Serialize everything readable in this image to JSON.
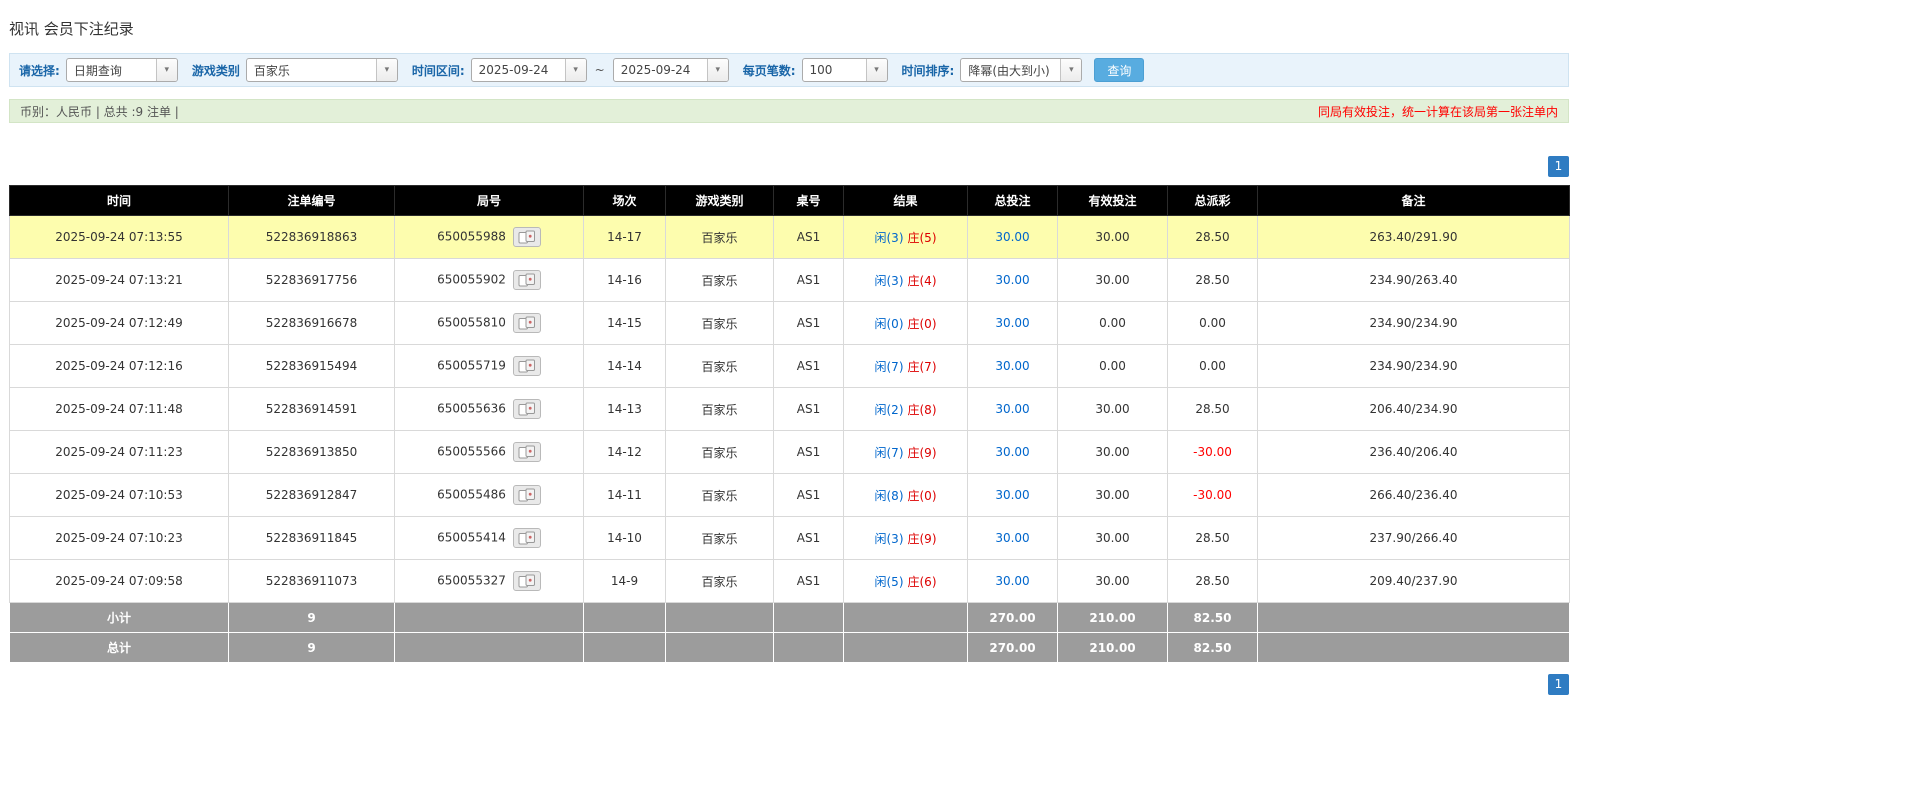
{
  "page": {
    "title": "视讯 会员下注纪录"
  },
  "colors": {
    "link-blue": "#0066cc",
    "banker-red": "#dd0000",
    "negative-red": "#ff0000",
    "header-bg": "#000000",
    "highlight": "#fdfdae",
    "summary-bg": "#e3f0d9",
    "filter-bg": "#e9f3fb",
    "label-blue": "#1a66a8",
    "button-blue": "#58ace0",
    "pagination-blue": "#2f7cc2",
    "footer-gray": "#9c9c9c"
  },
  "filters": {
    "select_label": "请选择:",
    "select_value": "日期查询",
    "game_type_label": "游戏类别",
    "game_type_value": "百家乐",
    "time_range_label": "时间区间:",
    "date_from": "2025-09-24",
    "range_separator": "~",
    "date_to": "2025-09-24",
    "page_size_label": "每页笔数:",
    "page_size_value": "100",
    "sort_label": "时间排序:",
    "sort_value": "降幂(由大到小)",
    "search_button": "查询"
  },
  "summary": {
    "left": "币别：人民币 | 总共 :9 注单 |",
    "right": "同局有效投注，统一计算在该局第一张注单内"
  },
  "pagination": {
    "page": "1"
  },
  "table": {
    "headers": [
      "时间",
      "注单编号",
      "局号",
      "场次",
      "游戏类别",
      "桌号",
      "结果",
      "总投注",
      "有效投注",
      "总派彩",
      "备注"
    ],
    "rows": [
      {
        "time": "2025-09-24 07:13:55",
        "bet_id": "522836918863",
        "round_id": "650055988",
        "session": "14-17",
        "game": "百家乐",
        "table_no": "AS1",
        "player": "闲(3)",
        "banker": "庄(5)",
        "total_bet": "30.00",
        "valid_bet": "30.00",
        "payout": "28.50",
        "remark": "263.40/291.90",
        "highlight": true
      },
      {
        "time": "2025-09-24 07:13:21",
        "bet_id": "522836917756",
        "round_id": "650055902",
        "session": "14-16",
        "game": "百家乐",
        "table_no": "AS1",
        "player": "闲(3)",
        "banker": "庄(4)",
        "total_bet": "30.00",
        "valid_bet": "30.00",
        "payout": "28.50",
        "remark": "234.90/263.40",
        "highlight": false
      },
      {
        "time": "2025-09-24 07:12:49",
        "bet_id": "522836916678",
        "round_id": "650055810",
        "session": "14-15",
        "game": "百家乐",
        "table_no": "AS1",
        "player": "闲(0)",
        "banker": "庄(0)",
        "total_bet": "30.00",
        "valid_bet": "0.00",
        "payout": "0.00",
        "remark": "234.90/234.90",
        "highlight": false
      },
      {
        "time": "2025-09-24 07:12:16",
        "bet_id": "522836915494",
        "round_id": "650055719",
        "session": "14-14",
        "game": "百家乐",
        "table_no": "AS1",
        "player": "闲(7)",
        "banker": "庄(7)",
        "total_bet": "30.00",
        "valid_bet": "0.00",
        "payout": "0.00",
        "remark": "234.90/234.90",
        "highlight": false
      },
      {
        "time": "2025-09-24 07:11:48",
        "bet_id": "522836914591",
        "round_id": "650055636",
        "session": "14-13",
        "game": "百家乐",
        "table_no": "AS1",
        "player": "闲(2)",
        "banker": "庄(8)",
        "total_bet": "30.00",
        "valid_bet": "30.00",
        "payout": "28.50",
        "remark": "206.40/234.90",
        "highlight": false
      },
      {
        "time": "2025-09-24 07:11:23",
        "bet_id": "522836913850",
        "round_id": "650055566",
        "session": "14-12",
        "game": "百家乐",
        "table_no": "AS1",
        "player": "闲(7)",
        "banker": "庄(9)",
        "total_bet": "30.00",
        "valid_bet": "30.00",
        "payout": "-30.00",
        "remark": "236.40/206.40",
        "highlight": false
      },
      {
        "time": "2025-09-24 07:10:53",
        "bet_id": "522836912847",
        "round_id": "650055486",
        "session": "14-11",
        "game": "百家乐",
        "table_no": "AS1",
        "player": "闲(8)",
        "banker": "庄(0)",
        "total_bet": "30.00",
        "valid_bet": "30.00",
        "payout": "-30.00",
        "remark": "266.40/236.40",
        "highlight": false
      },
      {
        "time": "2025-09-24 07:10:23",
        "bet_id": "522836911845",
        "round_id": "650055414",
        "session": "14-10",
        "game": "百家乐",
        "table_no": "AS1",
        "player": "闲(3)",
        "banker": "庄(9)",
        "total_bet": "30.00",
        "valid_bet": "30.00",
        "payout": "28.50",
        "remark": "237.90/266.40",
        "highlight": false
      },
      {
        "time": "2025-09-24 07:09:58",
        "bet_id": "522836911073",
        "round_id": "650055327",
        "session": "14-9",
        "game": "百家乐",
        "table_no": "AS1",
        "player": "闲(5)",
        "banker": "庄(6)",
        "total_bet": "30.00",
        "valid_bet": "30.00",
        "payout": "28.50",
        "remark": "209.40/237.90",
        "highlight": false
      }
    ],
    "subtotal": {
      "label": "小计",
      "count": "9",
      "total_bet": "270.00",
      "valid_bet": "210.00",
      "payout": "82.50"
    },
    "total": {
      "label": "总计",
      "count": "9",
      "total_bet": "270.00",
      "valid_bet": "210.00",
      "payout": "82.50"
    }
  }
}
